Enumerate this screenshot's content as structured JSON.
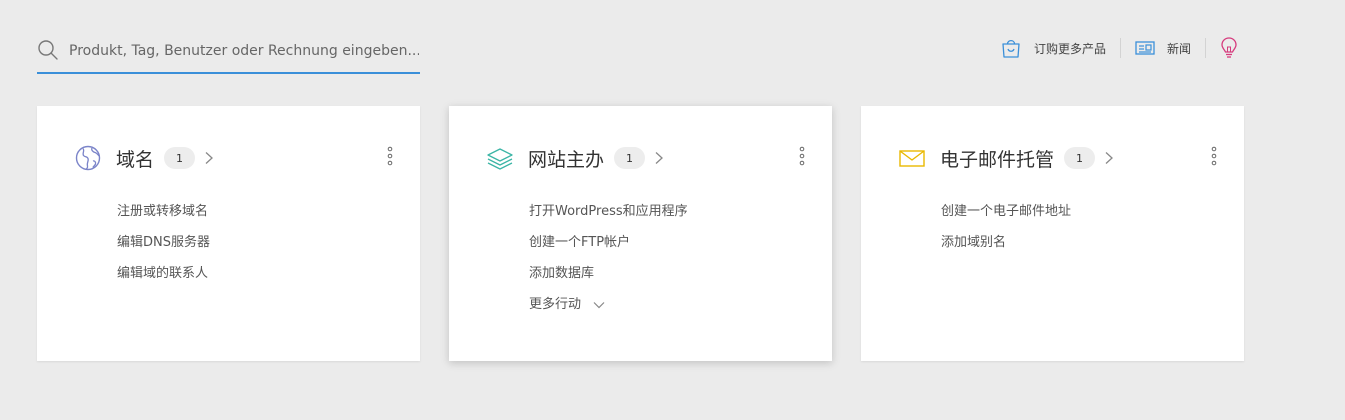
{
  "search": {
    "placeholder": "Produkt, Tag, Benutzer oder Rechnung eingeben..."
  },
  "topbar": {
    "order_more_label": "订购更多产品",
    "news_label": "新闻"
  },
  "colors": {
    "accent": "#3a8fd9",
    "domain_icon": "#7b84c9",
    "hosting_icon": "#3bb5a6",
    "email_icon": "#e9b800",
    "bulb_icon": "#d63b7d"
  },
  "cards": [
    {
      "title": "域名",
      "count": "1",
      "icon": "globe-icon",
      "links": [
        "注册或转移域名",
        "编辑DNS服务器",
        "编辑域的联系人"
      ]
    },
    {
      "title": "网站主办",
      "count": "1",
      "icon": "layers-icon",
      "links": [
        "打开WordPress和应用程序",
        "创建一个FTP帐户",
        "添加数据库"
      ],
      "more_label": "更多行动"
    },
    {
      "title": "电子邮件托管",
      "count": "1",
      "icon": "envelope-icon",
      "links": [
        "创建一个电子邮件地址",
        "添加域别名"
      ]
    }
  ]
}
